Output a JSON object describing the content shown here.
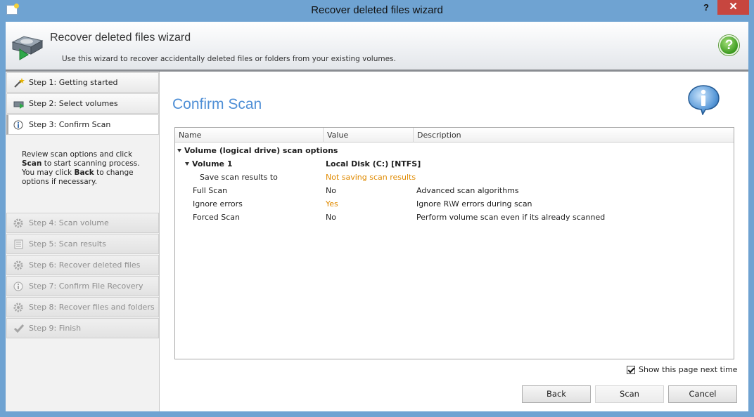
{
  "window": {
    "title": "Recover deleted files wizard",
    "help_glyph": "?",
    "close_glyph": "✕"
  },
  "header": {
    "title": "Recover deleted files wizard",
    "subtitle": "Use this wizard to recover accidentally deleted files or folders from your existing volumes.",
    "help_glyph": "?"
  },
  "sidebar": {
    "steps": [
      {
        "label": "Step 1: Getting started",
        "icon": "wand-icon",
        "state": "done"
      },
      {
        "label": "Step 2: Select volumes",
        "icon": "drive-icon",
        "state": "done"
      },
      {
        "label": "Step 3: Confirm Scan",
        "icon": "info-icon",
        "state": "active"
      },
      {
        "label": "Step 4: Scan volume",
        "icon": "gear-icon",
        "state": "disabled"
      },
      {
        "label": "Step 5: Scan results",
        "icon": "list-icon",
        "state": "disabled"
      },
      {
        "label": "Step 6: Recover deleted files",
        "icon": "gear-icon",
        "state": "disabled"
      },
      {
        "label": "Step 7: Confirm File Recovery",
        "icon": "info-icon",
        "state": "disabled"
      },
      {
        "label": "Step 8: Recover files and folders",
        "icon": "gear-icon",
        "state": "disabled"
      },
      {
        "label": "Step 9: Finish",
        "icon": "check-icon",
        "state": "disabled"
      }
    ],
    "description": {
      "line1_a": "Review scan options and click",
      "line2_b": "Scan",
      "line2_a": " to start scanning process.",
      "line3_a": "You may click ",
      "line3_b": "Back",
      "line3_c": " to change",
      "line4_a": "options if necessary."
    }
  },
  "main": {
    "title": "Confirm Scan",
    "grid": {
      "columns": [
        "Name",
        "Value",
        "Description"
      ],
      "group": "Volume (logical drive) scan options",
      "volume": {
        "name": "Volume 1",
        "value": "Local Disk (C:) [NTFS]"
      },
      "rows": [
        {
          "name": "Save scan results to",
          "value": "Not saving scan results",
          "description": "",
          "highlight": true
        },
        {
          "name": "Full Scan",
          "value": "No",
          "description": "Advanced scan algorithms",
          "highlight": false
        },
        {
          "name": "Ignore errors",
          "value": "Yes",
          "description": "Ignore R\\W errors during scan",
          "highlight": true
        },
        {
          "name": "Forced Scan",
          "value": "No",
          "description": "Perform volume scan even if its already scanned",
          "highlight": false
        }
      ]
    },
    "show_page_label": "Show this page next time",
    "show_page_checked": true,
    "buttons": {
      "back": "Back",
      "scan": "Scan",
      "cancel": "Cancel"
    }
  },
  "colors": {
    "accent_title": "#4f8fd6",
    "highlight_value": "#e08a00",
    "titlebar": "#6fa3d2",
    "close": "#c7463f"
  }
}
